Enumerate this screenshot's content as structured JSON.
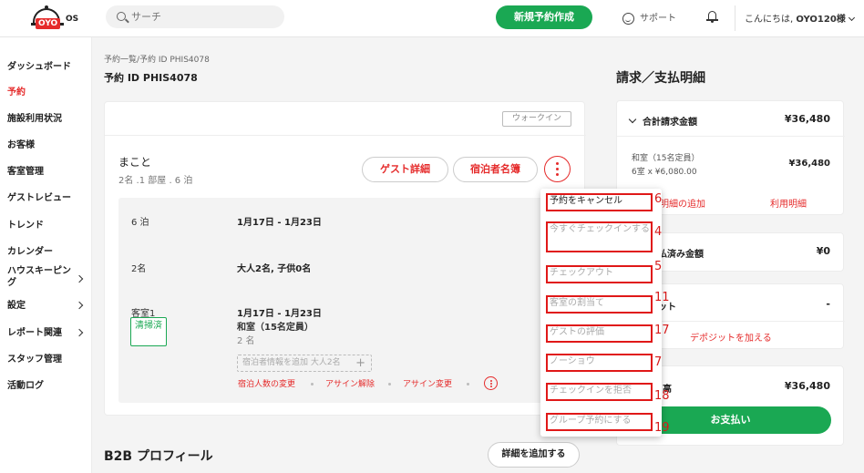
{
  "header": {
    "logo_brand": "OYO",
    "logo_suffix": "OS",
    "search_placeholder": "サーチ",
    "new_booking": "新規予約作成",
    "support": "サポート",
    "greeting_prefix": "こんにちは,",
    "greeting_name": "OYO120様"
  },
  "sidebar": {
    "items": [
      {
        "label": "ダッシュボード",
        "active": false
      },
      {
        "label": "予約",
        "active": true
      },
      {
        "label": "施設利用状況",
        "active": false
      },
      {
        "label": "お客様",
        "active": false
      },
      {
        "label": "客室管理",
        "active": false
      },
      {
        "label": "ゲストレビュー",
        "active": false
      },
      {
        "label": "トレンド",
        "active": false
      },
      {
        "label": "カレンダー",
        "active": false
      },
      {
        "label": "ハウスキーピング",
        "active": false
      },
      {
        "label": "設定",
        "active": false
      },
      {
        "label": "レポート関連",
        "active": false
      },
      {
        "label": "スタッフ管理",
        "active": false
      },
      {
        "label": "活動ログ",
        "active": false
      }
    ]
  },
  "main": {
    "breadcrumb": "予約一覧/予約 ID PHIS4078",
    "title": "予約 ID PHIS4078",
    "walkin": "ウォークイン",
    "guest_name": "まこと",
    "guest_summary": "2名 .1 部屋 . 6 泊",
    "guest_detail_btn": "ゲスト詳細",
    "roster_btn": "宿泊者名簿",
    "nights_label": "6 泊",
    "nights_dates": "1月17日 - 1月23日",
    "people_label": "2名",
    "people_value": "大人2名, 子供0名",
    "room_label": "客室1",
    "room_status": "清掃済",
    "room_dates": "1月17日 - 1月23日",
    "room_type": "和室（15名定員）",
    "room_people": "2 名",
    "add_guest_info": "宿泊者情報を追加 大人2名",
    "add_plus": "+",
    "link_change_count": "宿泊人数の変更",
    "link_unassign": "アサイン解除",
    "link_change_assign": "アサイン変更",
    "b2b_title": "B2B プロフィール",
    "add_details_btn": "詳細を追加する"
  },
  "billing": {
    "title": "請求／支払明細",
    "total_label": "合計請求金額",
    "total_amount": "¥36,480",
    "room_line": "和室（15名定員）",
    "room_calc": "6室 x ¥6,080.00",
    "room_amount": "¥36,480",
    "add_detail_link": "明細の追加",
    "usage_link": "利用明細",
    "paid_label": "払済み金額",
    "paid_amount": "¥0",
    "deposit_label": "ット",
    "deposit_amount": "-",
    "add_deposit_link": "デポジットを加える",
    "balance_label": "高",
    "balance_amount": "¥36,480",
    "pay_btn": "お支払い"
  },
  "dropdown": {
    "items": [
      {
        "label": "予約をキャンセル",
        "num": "6",
        "enabled": true
      },
      {
        "label": "今すぐチェックインする",
        "num": "4",
        "enabled": false
      },
      {
        "label": "チェックアウト",
        "num": "5",
        "enabled": false
      },
      {
        "label": "客室の割当て",
        "num": "11",
        "enabled": false
      },
      {
        "label": "ゲストの評価",
        "num": "17",
        "enabled": false
      },
      {
        "label": "ノーショウ",
        "num": "7",
        "enabled": false
      },
      {
        "label": "チェックインを拒否",
        "num": "18",
        "enabled": false
      },
      {
        "label": "グループ予約にする",
        "num": "19",
        "enabled": false
      }
    ]
  },
  "colors": {
    "accent_red": "#e52b2b",
    "accent_green": "#1aa853",
    "annotation_red": "#e01818"
  }
}
